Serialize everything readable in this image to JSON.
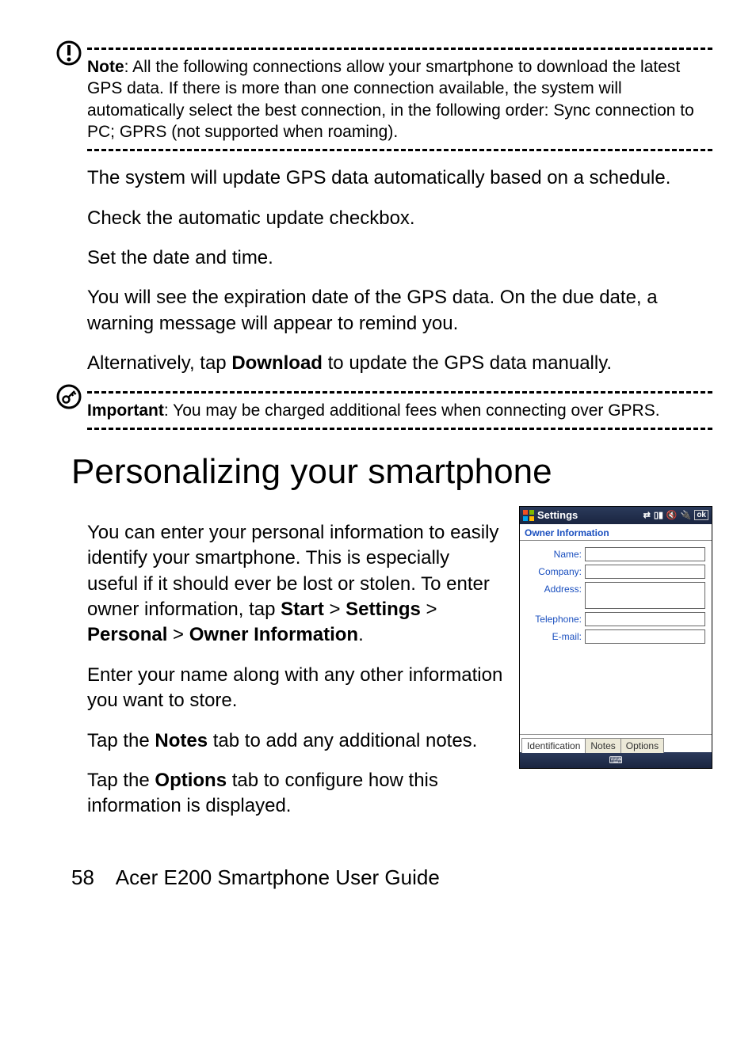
{
  "note": {
    "label": "Note",
    "text": ": All the following connections allow your smartphone to download the latest GPS data. If there is more than one connection available, the system will automatically select the best connection, in the following order: Sync connection to PC; GPRS (not supported when roaming)."
  },
  "paragraphs": {
    "p1": "The system will update GPS data automatically based on a schedule.",
    "p2": "Check the automatic update checkbox.",
    "p3": "Set the date and time.",
    "p4": "You will see the expiration date of the GPS data. On the due date, a warning message will appear to remind you.",
    "p5a": "Alternatively, tap ",
    "p5b": "Download",
    "p5c": " to update the GPS data manually."
  },
  "important": {
    "label": "Important",
    "text": ": You may be charged additional fees when connecting over GPRS."
  },
  "heading": "Personalizing your smartphone",
  "personalize": {
    "p1a": "You can enter your personal information to easily identify your smartphone. This is especially useful if it should ever be lost or stolen. To enter owner information, tap ",
    "p1b": "Start",
    "p1c": "Settings",
    "p1d": "Personal",
    "p1e": "Owner Information",
    "p1sep": " > ",
    "p1end": ".",
    "p2": "Enter your name along with any other information you want to store.",
    "p3a": "Tap the ",
    "p3b": "Notes",
    "p3c": " tab to add any additional notes.",
    "p4a": "Tap the ",
    "p4b": "Options",
    "p4c": " tab to configure how this information is displayed."
  },
  "screenshot": {
    "topTitle": "Settings",
    "ok": "ok",
    "header": "Owner Information",
    "labels": {
      "name": "Name:",
      "company": "Company:",
      "address": "Address:",
      "telephone": "Telephone:",
      "email": "E-mail:"
    },
    "tabs": {
      "identification": "Identification",
      "notes": "Notes",
      "options": "Options"
    }
  },
  "footer": {
    "page": "58",
    "title": "Acer E200 Smartphone User Guide"
  }
}
